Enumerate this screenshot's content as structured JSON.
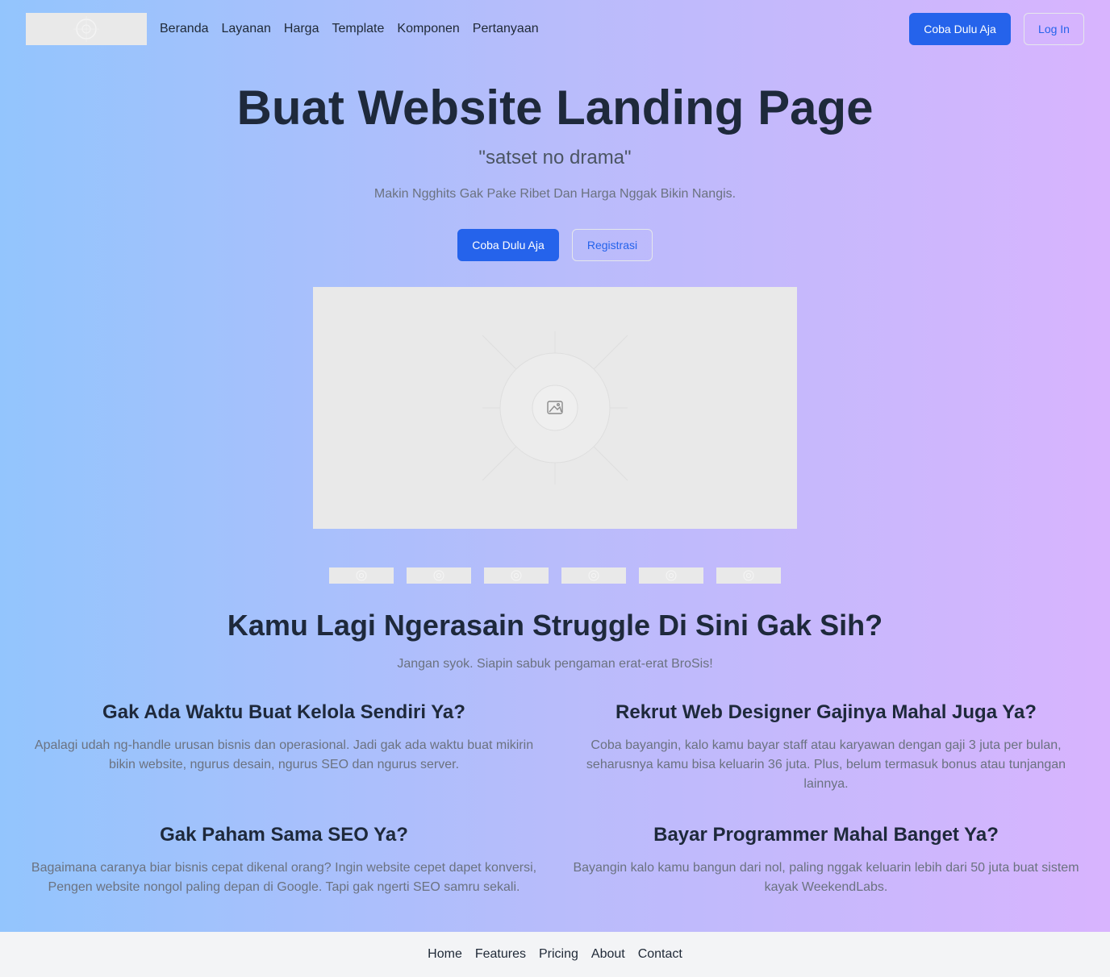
{
  "header": {
    "logo_icon": "image-placeholder-icon",
    "nav": [
      "Beranda",
      "Layanan",
      "Harga",
      "Template",
      "Komponen",
      "Pertanyaan"
    ],
    "cta_label": "Coba Dulu Aja",
    "login_label": "Log In"
  },
  "hero": {
    "title": "Buat Website Landing Page",
    "tagline": "\"satset no drama\"",
    "subtitle": "Makin Ngghits Gak Pake Ribet Dan Harga Nggak Bikin Nangis.",
    "primary_label": "Coba Dulu Aja",
    "secondary_label": "Registrasi",
    "image_icon": "image-placeholder-icon",
    "client_logos": 6
  },
  "struggle": {
    "title": "Kamu Lagi Ngerasain Struggle Di Sini Gak Sih?",
    "subtitle": "Jangan syok. Siapin sabuk pengaman erat-erat BroSis!",
    "cards": [
      {
        "title": "Gak Ada Waktu Buat Kelola Sendiri Ya?",
        "text": "Apalagi udah ng-handle urusan bisnis dan operasional. Jadi gak ada waktu buat mikirin bikin website, ngurus desain, ngurus SEO dan ngurus server."
      },
      {
        "title": "Rekrut Web Designer Gajinya Mahal Juga Ya?",
        "text": "Coba bayangin, kalo kamu bayar staff atau karyawan dengan gaji 3 juta per bulan, seharusnya kamu bisa keluarin 36 juta. Plus, belum termasuk bonus atau tunjangan lainnya."
      },
      {
        "title": "Gak Paham Sama SEO Ya?",
        "text": "Bagaimana caranya biar bisnis cepat dikenal orang? Ingin website cepet dapet konversi, Pengen website nongol paling depan di Google. Tapi gak ngerti SEO samru sekali."
      },
      {
        "title": "Bayar Programmer Mahal Banget Ya?",
        "text": "Bayangin kalo kamu bangun dari nol, paling nggak keluarin lebih dari 50 juta buat sistem kayak WeekendLabs."
      }
    ]
  },
  "footer": {
    "links": [
      "Home",
      "Features",
      "Pricing",
      "About",
      "Contact"
    ]
  },
  "colors": {
    "primary": "#2563eb",
    "gradient_start": "#93c5fd",
    "gradient_end": "#d8b4fe",
    "heading": "#1e293b",
    "muted": "#6b7280",
    "footer_bg": "#f3f4f6"
  }
}
